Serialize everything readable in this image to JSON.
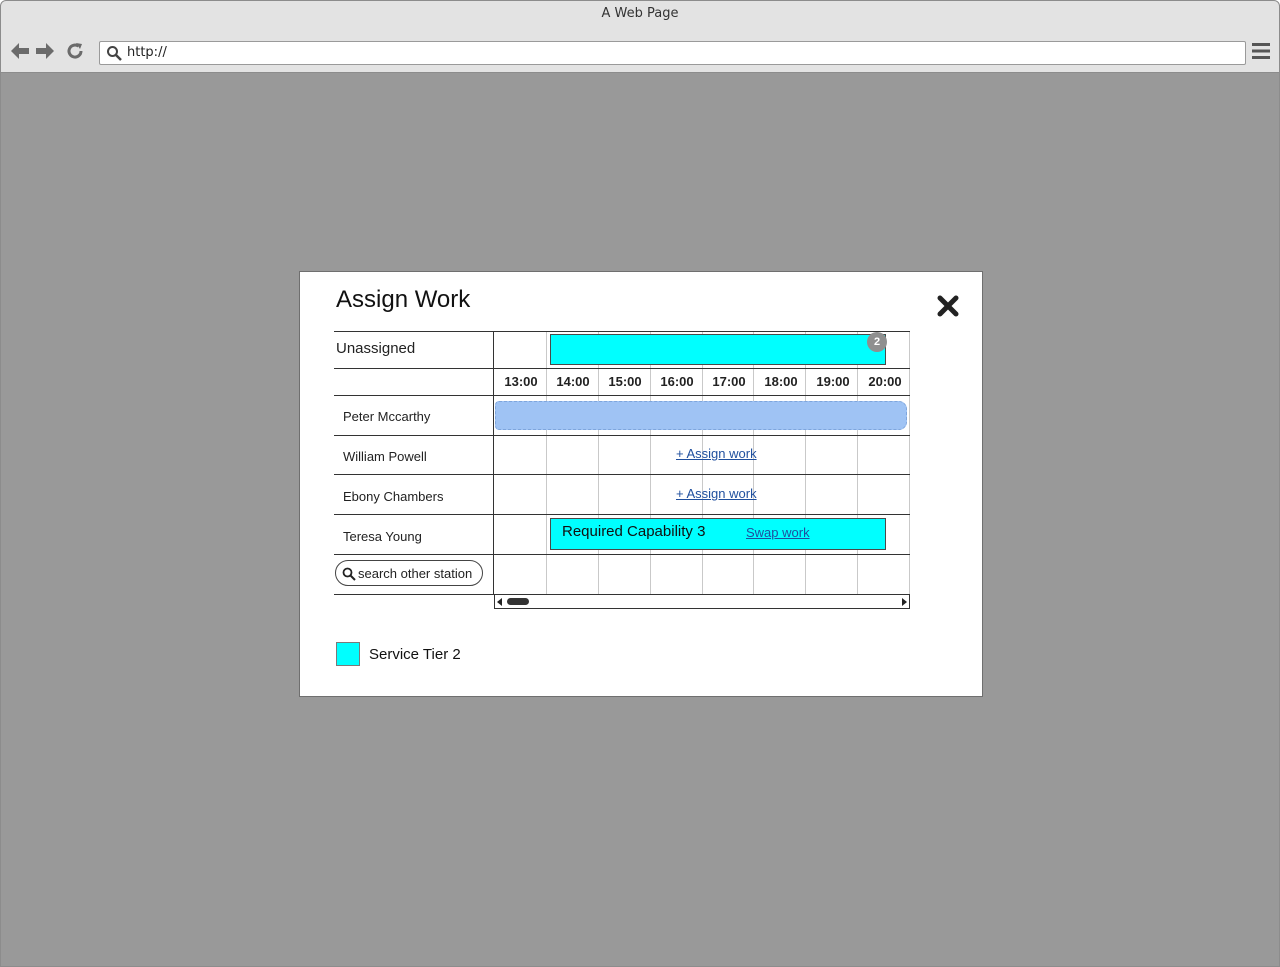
{
  "browser": {
    "window_title": "A Web Page",
    "url": "http://"
  },
  "modal": {
    "title": "Assign Work",
    "unassigned_label": "Unassigned",
    "unassigned_count": "2",
    "hours": [
      "13:00",
      "14:00",
      "15:00",
      "16:00",
      "17:00",
      "18:00",
      "19:00",
      "20:00"
    ],
    "staff": [
      {
        "name": "Peter Mccarthy"
      },
      {
        "name": "William Powell",
        "action": "+ Assign work"
      },
      {
        "name": "Ebony Chambers",
        "action": "+ Assign work"
      },
      {
        "name": "Teresa Young",
        "work_label": "Required Capability 3",
        "action": "Swap work"
      }
    ],
    "search_label": "search other station",
    "legend": {
      "label": "Service Tier 2",
      "color": "#00ffff"
    }
  },
  "colors": {
    "service_tier": "#00ffff",
    "pending_bar": "#9fc3f4",
    "link": "#1f4f9e",
    "overlay": "#999999"
  }
}
